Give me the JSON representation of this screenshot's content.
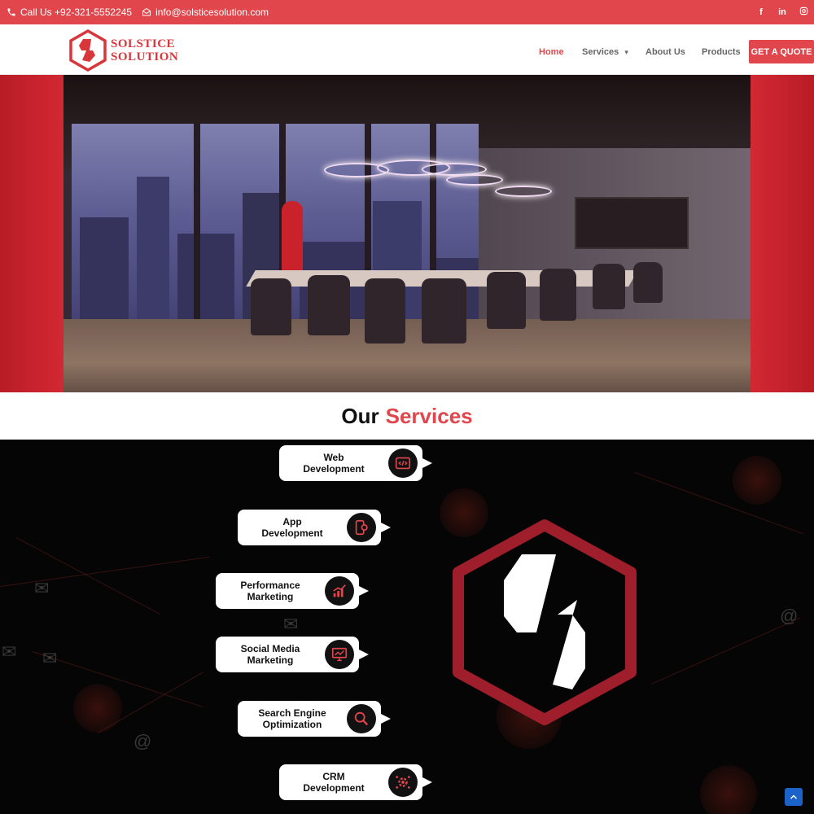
{
  "topbar": {
    "phone": "Call Us +92-321-5552245",
    "email": "info@solsticesolution.com",
    "socials": [
      "f",
      "in",
      "ig"
    ]
  },
  "header": {
    "logo_line1": "SOLSTICE",
    "logo_line2": "SOLUTION",
    "nav": [
      {
        "label": "Home",
        "active": true
      },
      {
        "label": "Services",
        "dropdown": true
      },
      {
        "label": "About Us"
      },
      {
        "label": "Products"
      }
    ],
    "quote_label": "GET A QUOTE"
  },
  "services_heading": {
    "part1": "Our",
    "part2": "Services"
  },
  "services": [
    {
      "line1": "Web",
      "line2": "Development",
      "icon": "code-window-icon"
    },
    {
      "line1": "App",
      "line2": "Development",
      "icon": "mobile-gear-icon"
    },
    {
      "line1": "Performance",
      "line2": "Marketing",
      "icon": "growth-chart-icon"
    },
    {
      "line1": "Social Media",
      "line2": "Marketing",
      "icon": "monitor-chart-icon"
    },
    {
      "line1": "Search Engine",
      "line2": "Optimization",
      "icon": "magnifier-icon"
    },
    {
      "line1": "CRM",
      "line2": "Development",
      "icon": "gear-network-icon"
    }
  ],
  "colors": {
    "brand": "#e0464b",
    "dark": "#050505",
    "logo_hex": "#9e1e2b"
  }
}
